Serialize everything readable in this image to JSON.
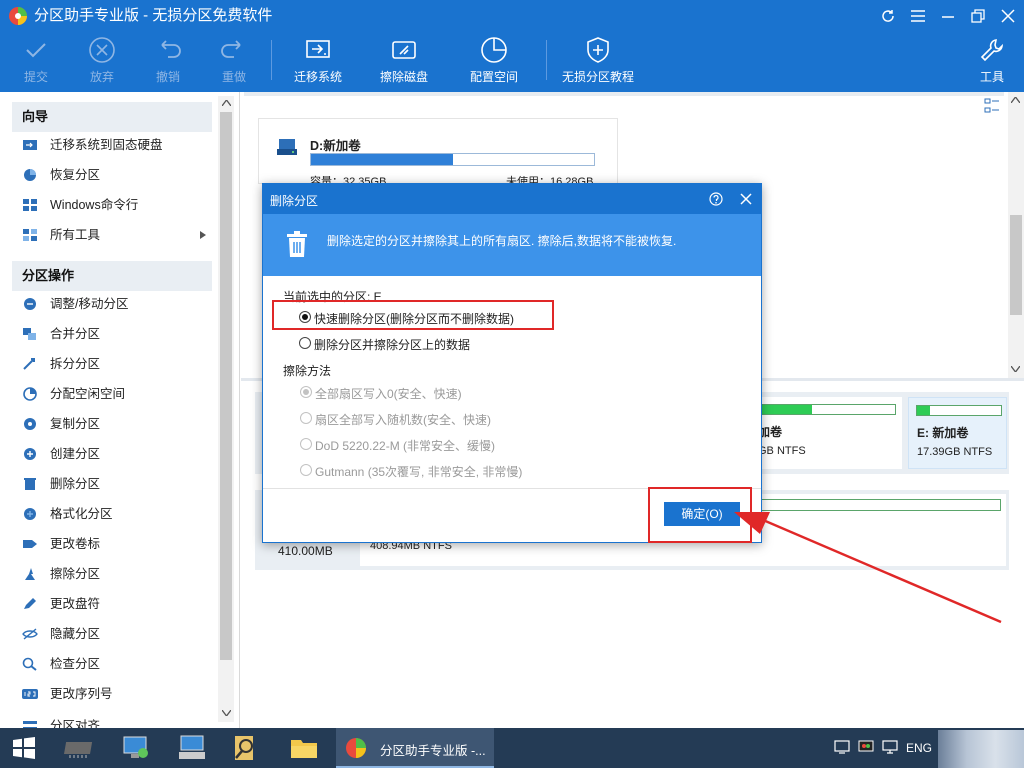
{
  "app": {
    "title": "分区助手专业版 - 无损分区免费软件"
  },
  "toolbar": {
    "items": [
      {
        "label": "提交",
        "icon": "check-icon",
        "enabled": false
      },
      {
        "label": "放弃",
        "icon": "cancel-circle-icon",
        "enabled": false
      },
      {
        "label": "撤销",
        "icon": "undo-icon",
        "enabled": false
      },
      {
        "label": "重做",
        "icon": "redo-icon",
        "enabled": false
      },
      {
        "label": "迁移系统",
        "icon": "migrate-os-icon",
        "enabled": true
      },
      {
        "label": "擦除磁盘",
        "icon": "wipe-disk-icon",
        "enabled": true
      },
      {
        "label": "配置空间",
        "icon": "allocate-space-icon",
        "enabled": true
      },
      {
        "label": "无损分区教程",
        "icon": "shield-plus-icon",
        "enabled": true
      },
      {
        "label": "工具",
        "icon": "wrench-icon",
        "enabled": true
      }
    ]
  },
  "sidebar": {
    "wizard_title": "向导",
    "wizard_items": [
      {
        "label": "迁移系统到固态硬盘",
        "icon": "migrate-ssd-icon"
      },
      {
        "label": "恢复分区",
        "icon": "restore-partition-icon"
      },
      {
        "label": "Windows命令行",
        "icon": "windows-cmd-icon"
      },
      {
        "label": "所有工具",
        "icon": "all-tools-icon",
        "has_arrow": true
      }
    ],
    "ops_title": "分区操作",
    "ops_items": [
      {
        "label": "调整/移动分区",
        "icon": "resize-move-icon"
      },
      {
        "label": "合并分区",
        "icon": "merge-partition-icon"
      },
      {
        "label": "拆分分区",
        "icon": "split-partition-icon"
      },
      {
        "label": "分配空闲空间",
        "icon": "allocate-free-space-icon"
      },
      {
        "label": "复制分区",
        "icon": "copy-partition-icon"
      },
      {
        "label": "创建分区",
        "icon": "create-partition-icon"
      },
      {
        "label": "删除分区",
        "icon": "delete-partition-icon"
      },
      {
        "label": "格式化分区",
        "icon": "format-partition-icon"
      },
      {
        "label": "更改卷标",
        "icon": "change-label-icon"
      },
      {
        "label": "擦除分区",
        "icon": "wipe-partition-icon"
      },
      {
        "label": "更改盘符",
        "icon": "change-drive-letter-icon"
      },
      {
        "label": "隐藏分区",
        "icon": "hide-partition-icon"
      },
      {
        "label": "检查分区",
        "icon": "check-partition-icon"
      },
      {
        "label": "更改序列号",
        "icon": "change-serial-icon"
      },
      {
        "label": "分区对齐",
        "icon": "align-partition-icon"
      }
    ]
  },
  "content": {
    "volume_card": {
      "name": "D:新加卷",
      "capacity": "容量：32.35GB",
      "unused": "未使用：16.28GB",
      "used_fraction": 0.5
    },
    "disk_map": {
      "partial_label": "加卷",
      "partial_fs": "GB NTFS",
      "e_name": "E: 新加卷",
      "e_info": "17.39GB NTFS",
      "disk2_size": "410.00MB",
      "disk2_fs": "408.94MB NTFS",
      "partial_used_fraction": 0.39,
      "e_used_fraction": 0.15
    }
  },
  "dialog": {
    "title": "删除分区",
    "info": "删除选定的分区并擦除其上的所有扇区. 擦除后,数据将不能被恢复.",
    "current_partition": "当前选中的分区: E",
    "options": [
      {
        "label": "快速删除分区(删除分区而不删除数据)",
        "selected": true
      },
      {
        "label": "删除分区并擦除分区上的数据",
        "selected": false
      }
    ],
    "wipe_title": "擦除方法",
    "wipe_methods": [
      {
        "label": "全部扇区写入0(安全、快速)",
        "selected": true
      },
      {
        "label": "扇区全部写入随机数(安全、快速)",
        "selected": false
      },
      {
        "label": "DoD 5220.22-M (非常安全、缓慢)",
        "selected": false
      },
      {
        "label": "Gutmann (35次覆写, 非常安全, 非常慢)",
        "selected": false
      }
    ],
    "ok_label": "确定(O)"
  },
  "taskbar": {
    "active_app": "分区助手专业版 -...",
    "lang": "ENG"
  },
  "colors": {
    "accent": "#1a73cf",
    "highlight": "#e02828",
    "bar_fill": "#2f80d8",
    "green": "#2ecc55"
  }
}
